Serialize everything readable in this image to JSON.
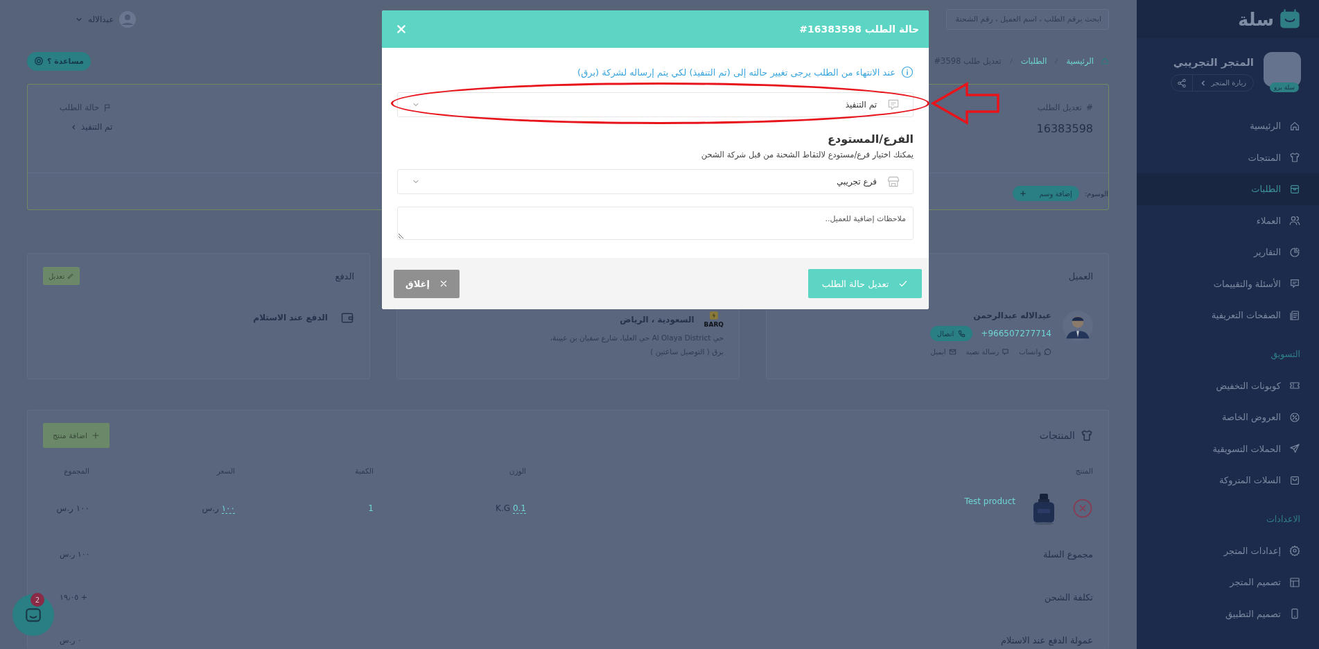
{
  "topbar": {
    "search": {
      "placeholder": "ابحث برقم الطلب ، اسم العميل ، رقم الشحنة"
    },
    "user": {
      "name": "عبدالاله"
    }
  },
  "breadcrumb": [
    {
      "label": "الرئيسية"
    },
    {
      "label": "الطلبات"
    },
    {
      "label": "تعديل طلب 3598#"
    }
  ],
  "help_button": "مساعدة ؟",
  "order": {
    "title_mark": "#",
    "title": "تعديل الطلب",
    "number": "16383598",
    "status_label": "حالة الطلب",
    "status": "تم التنفيذ",
    "tags_label": "الوسوم:",
    "add_tag": "إضافة وسم"
  },
  "customer": {
    "heading": "العميل",
    "name": "عبدالاله عبدالرحمن",
    "phone": "+966507277714",
    "call": "اتصال",
    "links": [
      {
        "kind": "whatsapp",
        "label": "واتساب"
      },
      {
        "kind": "sms",
        "label": "رسالة نصية"
      },
      {
        "kind": "email",
        "label": "ايميل"
      }
    ]
  },
  "shipping": {
    "carrier": "BARQ",
    "city": "السعودية ، الرياض",
    "address": "حي Al Olaya District حي العليا، شارع سفيان بن عيينة،",
    "method": "برق ( التوصيل ساعتين )"
  },
  "payment": {
    "heading": "الدفع",
    "edit": "تعديل",
    "method": "الدفع عند الاستلام"
  },
  "products": {
    "heading": "المنتجات",
    "add": "اضافة منتج",
    "columns": [
      "المنتج",
      "الوزن",
      "الكمية",
      "السعر",
      "المجموع"
    ],
    "rows": [
      {
        "name": "Test product",
        "weight": "0.1",
        "weight_unit": "K.G",
        "quantity": "1",
        "price": "١٠٠",
        "currency": "ر.س",
        "total": "١٠٠ ر.س"
      }
    ],
    "summary": [
      {
        "label": "مجموع السلة",
        "value": "١٠٠ ر.س"
      },
      {
        "label": "تكلفة الشحن",
        "value": "+ ١٩٫٠٥"
      },
      {
        "label": "عمولة الدفع عند الاستلام",
        "value": "٠ ر.س"
      }
    ]
  },
  "chat": {
    "badge": "2"
  },
  "sidebar": {
    "logo": "سلة",
    "store_name": "المتجر التجريبي",
    "visit": "زيارة المتجر",
    "plan_badge": "سلة برو",
    "items": [
      {
        "kind": "link",
        "label": "الرئيسية",
        "selected": false
      },
      {
        "kind": "link",
        "label": "المنتجات",
        "selected": false
      },
      {
        "kind": "link",
        "label": "الطلبات",
        "selected": true
      },
      {
        "kind": "link",
        "label": "العملاء",
        "selected": false
      },
      {
        "kind": "link",
        "label": "التقارير",
        "selected": false
      },
      {
        "kind": "link",
        "label": "الأسئلة والتقييمات",
        "selected": false
      },
      {
        "kind": "link",
        "label": "الصفحات التعريفية",
        "selected": false
      },
      {
        "kind": "heading",
        "label": "التسويق"
      },
      {
        "kind": "link",
        "label": "كوبونات التخفيض",
        "selected": false
      },
      {
        "kind": "link",
        "label": "العروض الخاصة",
        "selected": false
      },
      {
        "kind": "link",
        "label": "الحملات التسويقية",
        "selected": false
      },
      {
        "kind": "link",
        "label": "السلات المتروكة",
        "selected": false
      },
      {
        "kind": "heading",
        "label": "الاعدادات"
      },
      {
        "kind": "link",
        "label": "إعدادات المتجر",
        "selected": false
      },
      {
        "kind": "link",
        "label": "تصميم المتجر",
        "selected": false
      },
      {
        "kind": "link",
        "label": "تصميم التطبيق",
        "selected": false
      }
    ]
  },
  "modal": {
    "title": "حالة الطلب 16383598#",
    "notice": "عند الانتهاء من الطلب يرجى تغيير حالته إلى (تم التنفيذ) لكي يتم إرساله لشركة (برق)",
    "status": {
      "value": "تم التنفيذ"
    },
    "branch_heading": "الفرع/المستودع",
    "branch_hint": "يمكنك اختيار فرع/مستودع لالتقاط الشحنة من قبل شركة الشحن",
    "branch": {
      "value": "فرع تجريبي"
    },
    "notes": {
      "placeholder": "ملاحظات إضافية للعميل.."
    },
    "submit": "تعديل حالة الطلب",
    "close": "إغلاق"
  }
}
